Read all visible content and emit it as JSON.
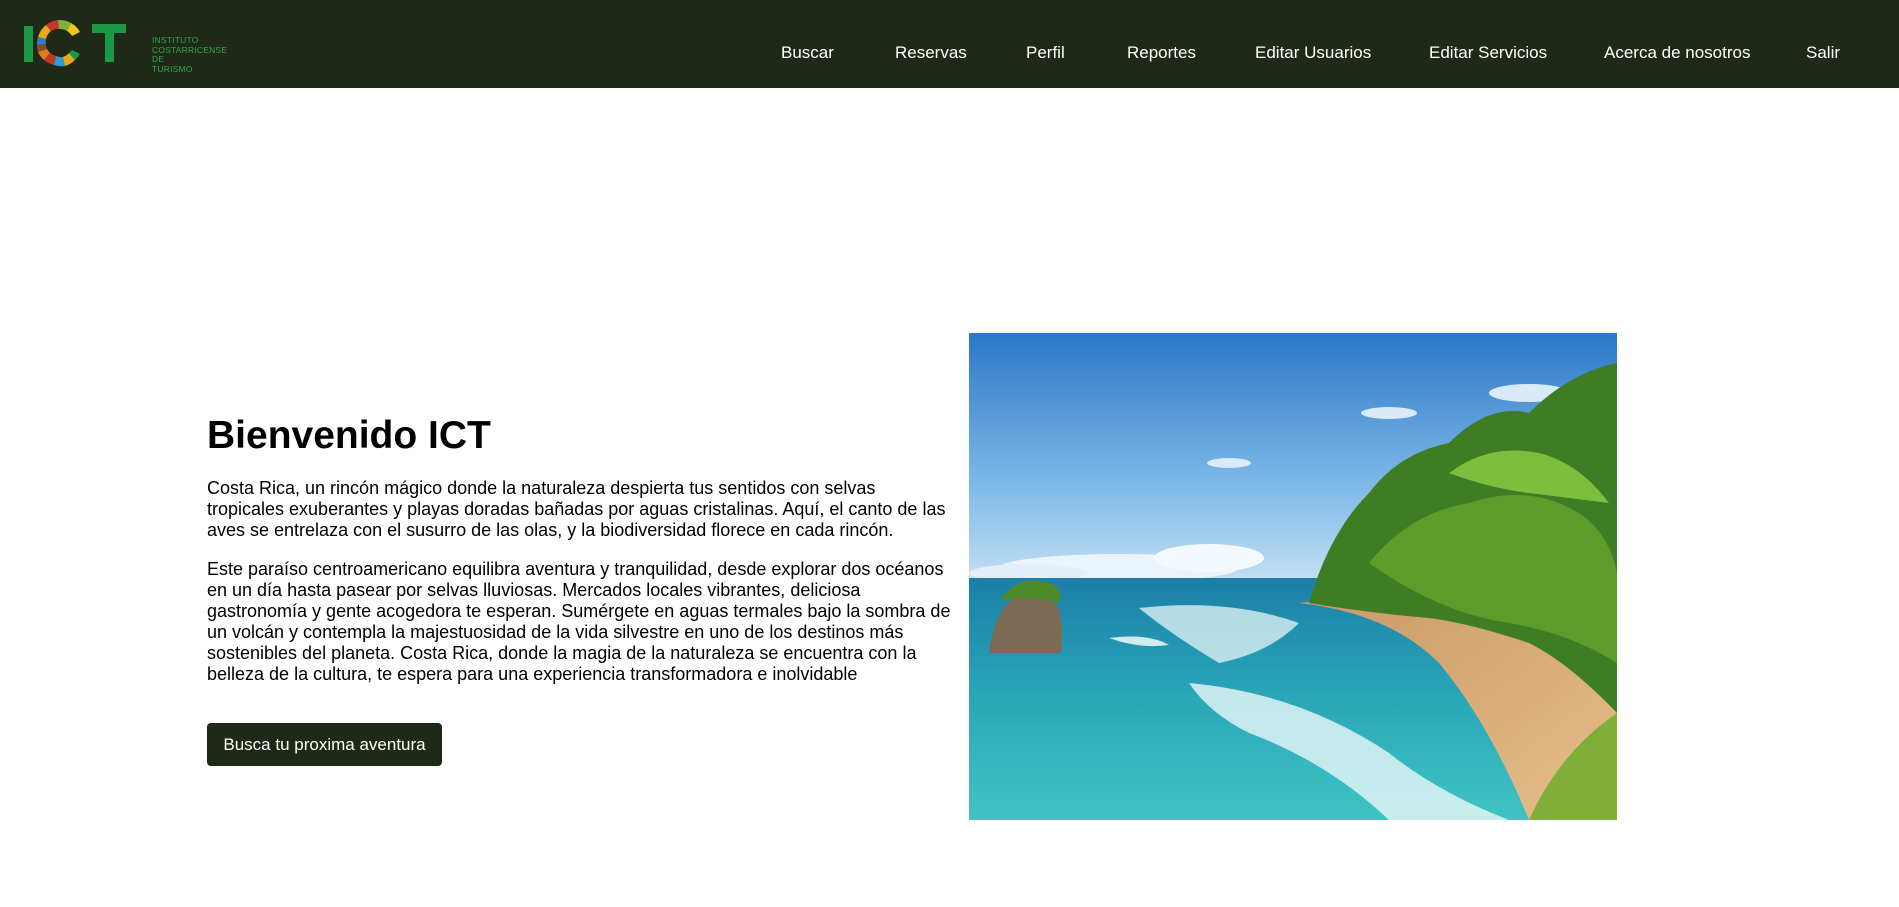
{
  "header": {
    "logo": {
      "letters": "ICT",
      "lines": [
        "INSTITUTO",
        "COSTARRICENSE DE",
        "TURISMO"
      ]
    },
    "nav": [
      {
        "label": "Buscar"
      },
      {
        "label": "Reservas"
      },
      {
        "label": "Perfil"
      },
      {
        "label": "Reportes"
      },
      {
        "label": "Editar Usuarios"
      },
      {
        "label": "Editar Servicios"
      },
      {
        "label": "Acerca de nosotros"
      },
      {
        "label": "Salir"
      }
    ]
  },
  "hero": {
    "title": "Bienvenido ICT",
    "paragraph1": "Costa Rica, un rincón mágico donde la naturaleza despierta tus sentidos con selvas tropicales exuberantes y playas doradas bañadas por aguas cristalinas. Aquí, el canto de las aves se entrelaza con el susurro de las olas, y la biodiversidad florece en cada rincón.",
    "paragraph2": "Este paraíso centroamericano equilibra aventura y tranquilidad, desde explorar dos océanos en un día hasta pasear por selvas lluviosas. Mercados locales vibrantes, deliciosa gastronomía y gente acogedora te esperan. Sumérgete en aguas termales bajo la sombra de un volcán y contempla la majestuosidad de la vida silvestre en uno de los destinos más sostenibles del planeta. Costa Rica, donde la magia de la naturaleza se encuentra con la belleza de la cultura, te espera para una experiencia transformadora e inolvidable",
    "cta_label": "Busca tu proxima aventura"
  },
  "colors": {
    "navbar": "#1f2917",
    "logo_green": "#1a9a45",
    "button_bg": "#1f2917"
  }
}
